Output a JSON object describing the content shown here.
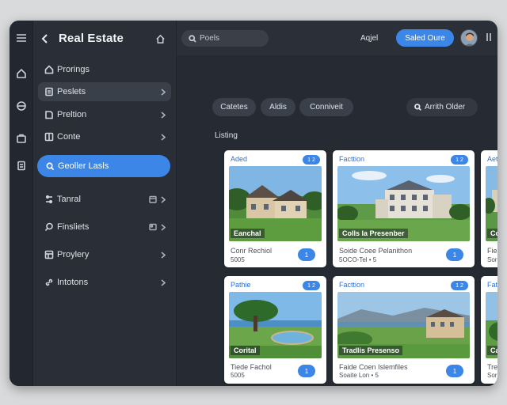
{
  "header": {
    "title": "Real Estate",
    "search_placeholder": "Poels",
    "link_label": "Aqjel",
    "cta_label": "Saled Oure"
  },
  "rail": {
    "icons": [
      "menu-icon",
      "home-icon",
      "globe-icon",
      "bag-icon",
      "clipboard-icon"
    ]
  },
  "sidebar": {
    "items": [
      {
        "label": "Prorings",
        "icon": "home-icon"
      },
      {
        "label": "Peslets",
        "icon": "doc-icon"
      },
      {
        "label": "Preltion",
        "icon": "doc-icon"
      },
      {
        "label": "Conte",
        "icon": "grid-icon"
      },
      {
        "label": "Geoller Lasls",
        "icon": "search-icon"
      },
      {
        "label": "Tanral",
        "icon": "sliders-icon"
      },
      {
        "label": "Finsliets",
        "icon": "search-icon"
      },
      {
        "label": "Proylery",
        "icon": "table-icon"
      },
      {
        "label": "Intotons",
        "icon": "link-icon"
      }
    ]
  },
  "filters": {
    "chips": [
      "Catetes",
      "Aldis",
      "Conniveit"
    ],
    "sort_label": "Arrith Older"
  },
  "listings": {
    "section_label": "Listing",
    "cards": [
      {
        "tag": "Aded",
        "pill": "1 2",
        "overlay": "Eanchal",
        "line1": "Conr Rechiol",
        "line2": "5005",
        "action": "1"
      },
      {
        "tag": "Facttion",
        "pill": "1 2",
        "overlay": "Colls la Presenber",
        "line1": "Soide Coee Pelanithon",
        "line2": "5OCO-Tel • 5",
        "action": "1"
      },
      {
        "tag": "Aetre",
        "pill": "1 2",
        "overlay": "Conai",
        "line1": "Fieal",
        "line2": "Sort",
        "action": "1"
      },
      {
        "tag": "Pathie",
        "pill": "1 2",
        "overlay": "Corital",
        "line1": "Tiede Fachol",
        "line2": "5005",
        "action": "1"
      },
      {
        "tag": "Facttion",
        "pill": "1 2",
        "overlay": "Tradlis Presenso",
        "line1": "Faide Coen Islemfiles",
        "line2": "Soaite Lon • 5",
        "action": "1"
      },
      {
        "tag": "Fath",
        "pill": "1 2",
        "overlay": "Call",
        "line1": "Tre",
        "line2": "Sor",
        "action": "1"
      }
    ]
  },
  "colors": {
    "accent": "#3b86e6",
    "sidebar_bg": "#2a2f37",
    "main_bg": "#262b33"
  }
}
